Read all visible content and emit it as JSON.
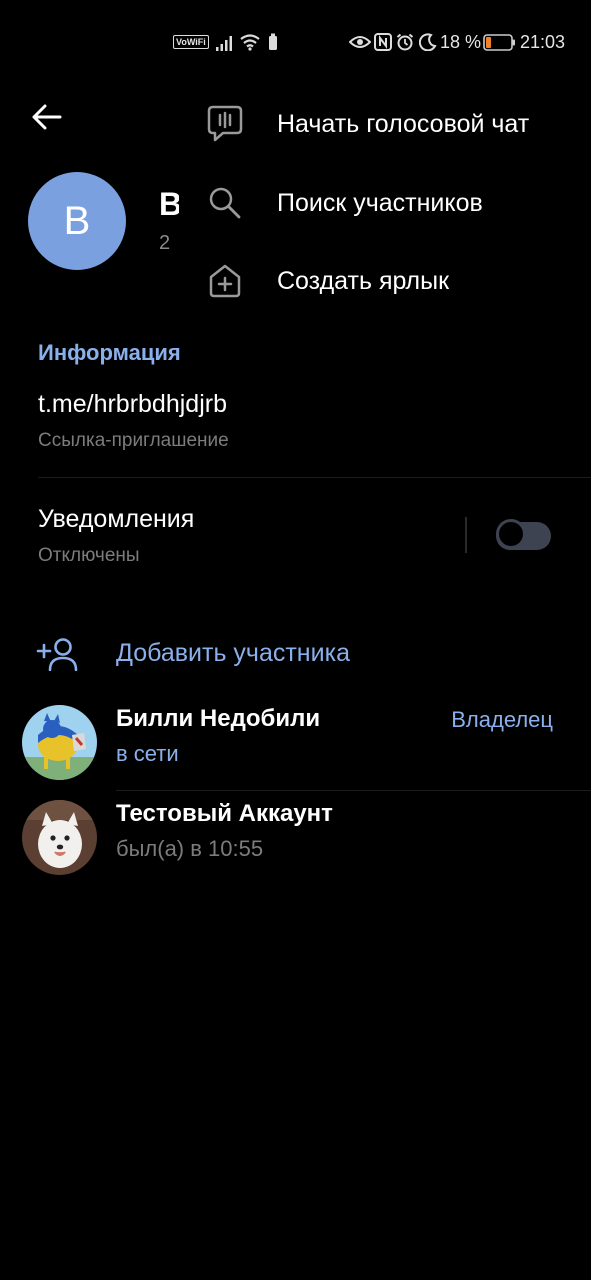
{
  "status_bar": {
    "network_label": "VoWiFi",
    "battery_percent": "18 %",
    "time": "21:03"
  },
  "header": {
    "avatar_letter": "B",
    "title_visible": "B",
    "subtitle_visible": "2"
  },
  "menu": {
    "items": [
      {
        "label": "Начать голосовой чат",
        "icon": "voice-chat-icon"
      },
      {
        "label": "Поиск участников",
        "icon": "search-icon"
      },
      {
        "label": "Создать ярлык",
        "icon": "add-shortcut-icon"
      }
    ]
  },
  "info": {
    "section_title": "Информация",
    "link": "t.me/hrbrbdhjdjrb",
    "link_caption": "Ссылка-приглашение",
    "notifications_title": "Уведомления",
    "notifications_state": "Отключены",
    "notifications_on": false
  },
  "members": {
    "add_label": "Добавить участника",
    "list": [
      {
        "name": "Билли Недобили",
        "status": "в сети",
        "role": "Владелец",
        "online": true
      },
      {
        "name": "Тестовый Аккаунт",
        "status": "был(а) в 10:55",
        "role": "",
        "online": false
      }
    ]
  },
  "colors": {
    "accent": "#8ab0ec",
    "background": "#000000",
    "secondary_text": "#7c7c7c",
    "avatar_bg": "#7aa0e0"
  }
}
